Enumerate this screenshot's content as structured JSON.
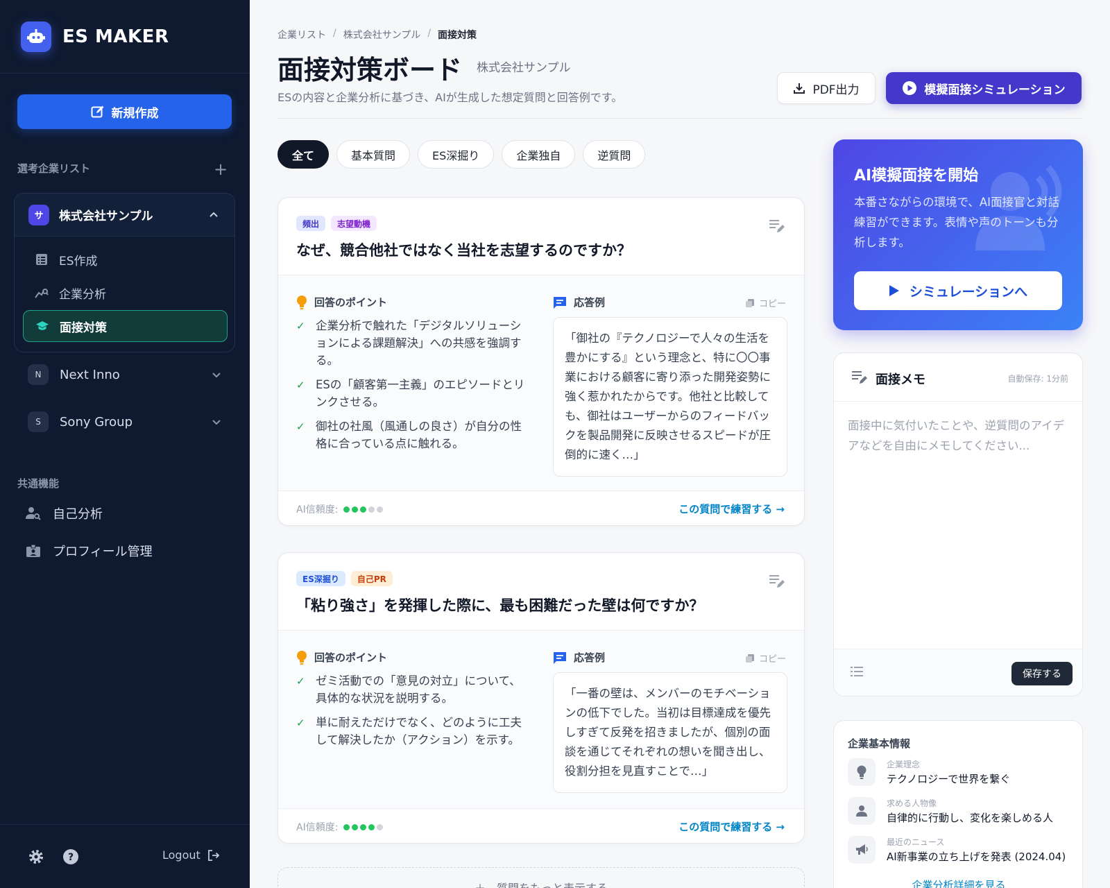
{
  "sidebar": {
    "brand": "ES MAKER",
    "new_button": "新規作成",
    "company_list_label": "選考企業リスト",
    "active_company": {
      "badge": "サ",
      "name": "株式会社サンプル",
      "items": [
        {
          "label": "ES作成"
        },
        {
          "label": "企業分析"
        },
        {
          "label": "面接対策"
        }
      ]
    },
    "other_companies": [
      {
        "badge": "N",
        "name": "Next Inno"
      },
      {
        "badge": "S",
        "name": "Sony Group"
      }
    ],
    "shared_label": "共通機能",
    "shared_items": [
      {
        "label": "自己分析"
      },
      {
        "label": "プロフィール管理"
      }
    ],
    "logout": "Logout"
  },
  "header": {
    "breadcrumb": [
      "企業リスト",
      "株式会社サンプル",
      "面接対策"
    ],
    "title": "面接対策ボード",
    "company": "株式会社サンプル",
    "description": "ESの内容と企業分析に基づき、AIが生成した想定質問と回答例です。",
    "pdf_button": "PDF出力",
    "sim_button": "模擬面接シミュレーション"
  },
  "tabs": [
    "全て",
    "基本質問",
    "ES深掘り",
    "企業独自",
    "逆質問"
  ],
  "questions": [
    {
      "tags": [
        {
          "label": "頻出",
          "bg": "#e0e7ff",
          "fg": "#4338ca"
        },
        {
          "label": "志望動機",
          "bg": "#f3e8ff",
          "fg": "#7e22ce"
        }
      ],
      "title": "なぜ、競合他社ではなく当社を志望するのですか？",
      "points_label": "回答のポイント",
      "points": [
        "企業分析で触れた「デジタルソリューションによる課題解決」への共感を強調する。",
        "ESの「顧客第一主義」のエピソードとリンクさせる。",
        "御社の社風（風通しの良さ）が自分の性格に合っている点に触れる。"
      ],
      "answer_label": "応答例",
      "copy_label": "コピー",
      "answer": "「御社の『テクノロジーで人々の生活を豊かにする』という理念と、特に〇〇事業における顧客に寄り添った開発姿勢に強く惹かれたからです。他社と比較しても、御社はユーザーからのフィードバックを製品開発に反映させるスピードが圧倒的に速く…」",
      "confidence_label": "AI信頼度:",
      "confidence": 3,
      "confidence_max": 5,
      "practice": "この質問で練習する →"
    },
    {
      "tags": [
        {
          "label": "ES深掘り",
          "bg": "#dbeafe",
          "fg": "#1d4ed8"
        },
        {
          "label": "自己PR",
          "bg": "#ffedd5",
          "fg": "#c2410c"
        }
      ],
      "title": "「粘り強さ」を発揮した際に、最も困難だった壁は何ですか？",
      "points_label": "回答のポイント",
      "points": [
        "ゼミ活動での「意見の対立」について、具体的な状況を説明する。",
        "単に耐えただけでなく、どのように工夫して解決したか（アクション）を示す。"
      ],
      "answer_label": "応答例",
      "copy_label": "コピー",
      "answer": "「一番の壁は、メンバーのモチベーションの低下でした。当初は目標達成を優先しすぎて反発を招きましたが、個別の面談を通じてそれぞれの想いを聞き出し、役割分担を見直すことで…」",
      "confidence_label": "AI信頼度:",
      "confidence": 4,
      "confidence_max": 5,
      "practice": "この質問で練習する →"
    }
  ],
  "more_button": "＋　質問をもっと表示する",
  "ai_card": {
    "title": "AI模擬面接を開始",
    "description": "本番さながらの環境で、AI面接官と対話練習ができます。表情や声のトーンも分析します。",
    "button": "シミュレーションへ"
  },
  "memo": {
    "title": "面接メモ",
    "autosave": "自動保存: 1分前",
    "placeholder": "面接中に気付いたことや、逆質問のアイデアなどを自由にメモしてください...",
    "save": "保存する"
  },
  "company_info": {
    "title": "企業基本情報",
    "rows": [
      {
        "label": "企業理念",
        "value": "テクノロジーで世界を繋ぐ",
        "icon": "lightbulb-icon"
      },
      {
        "label": "求める人物像",
        "value": "自律的に行動し、変化を楽しめる人",
        "icon": "person-icon"
      },
      {
        "label": "最近のニュース",
        "value": "AI新事業の立ち上げを発表 (2024.04)",
        "icon": "megaphone-icon"
      }
    ],
    "link": "企業分析詳細を見る"
  },
  "colors": {
    "sidebar_bg": "#0f1a31",
    "primary": "#2563eb",
    "accent_indigo": "#4338ca",
    "active_teal": "#1ea38a"
  }
}
